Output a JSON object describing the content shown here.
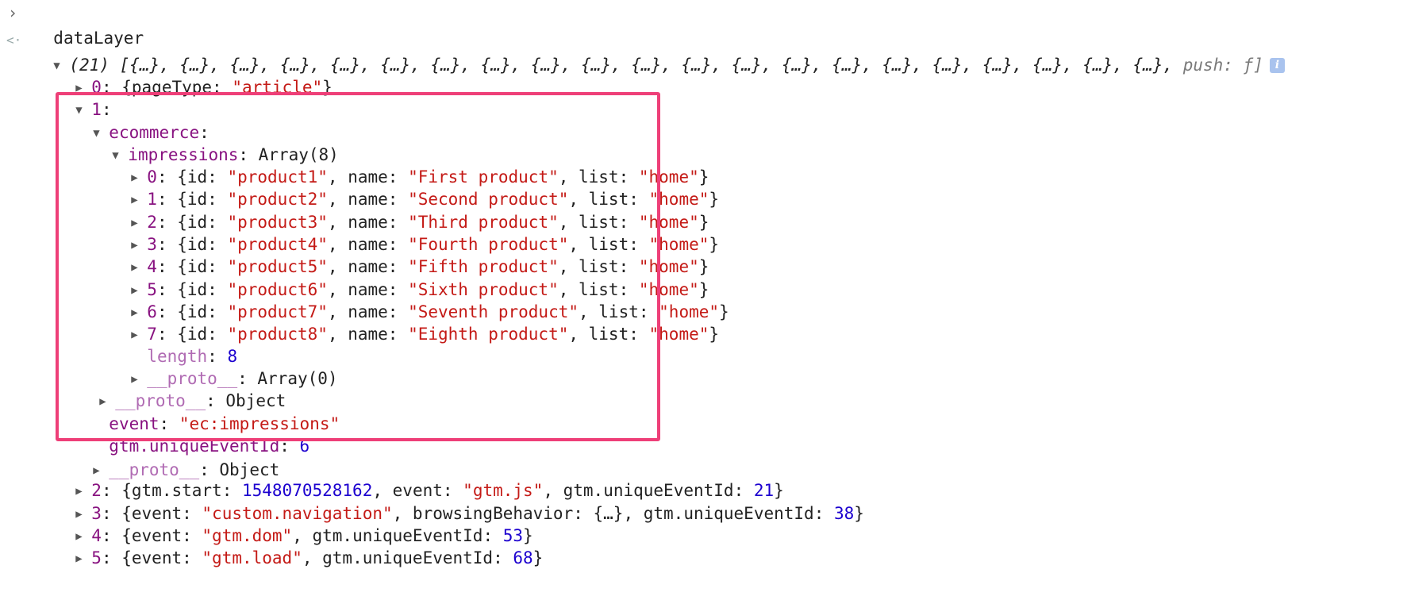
{
  "console": {
    "input_expression": "dataLayer",
    "summary_count": "(21)",
    "summary_items": "[{…}, {…}, {…}, {…}, {…}, {…}, {…}, {…}, {…}, {…}, {…}, {…}, {…}, {…}, {…}, {…}, {…}, {…}, {…}, {…}, {…}, ",
    "summary_push": "push: ƒ]",
    "info_badge": "i"
  },
  "entry0": {
    "index": "0",
    "key": "pageType",
    "value": "\"article\""
  },
  "entry1": {
    "index": "1"
  },
  "ecommerce": {
    "key": "ecommerce",
    "impressions_key": "impressions",
    "impressions_type": "Array(8)",
    "products": [
      {
        "index": "0",
        "id": "\"product1\"",
        "name": "\"First product\"",
        "list": "\"home\""
      },
      {
        "index": "1",
        "id": "\"product2\"",
        "name": "\"Second product\"",
        "list": "\"home\""
      },
      {
        "index": "2",
        "id": "\"product3\"",
        "name": "\"Third product\"",
        "list": "\"home\""
      },
      {
        "index": "3",
        "id": "\"product4\"",
        "name": "\"Fourth product\"",
        "list": "\"home\""
      },
      {
        "index": "4",
        "id": "\"product5\"",
        "name": "\"Fifth product\"",
        "list": "\"home\""
      },
      {
        "index": "5",
        "id": "\"product6\"",
        "name": "\"Sixth product\"",
        "list": "\"home\""
      },
      {
        "index": "6",
        "id": "\"product7\"",
        "name": "\"Seventh product\"",
        "list": "\"home\""
      },
      {
        "index": "7",
        "id": "\"product8\"",
        "name": "\"Eighth product\"",
        "list": "\"home\""
      }
    ],
    "length_key": "length",
    "length_value": "8",
    "array_proto_key": "__proto__",
    "array_proto_value": "Array(0)",
    "ecommerce_proto_key": "__proto__",
    "ecommerce_proto_value": "Object",
    "event_key": "event",
    "event_value": "\"ec:impressions\"",
    "unique_key": "gtm.uniqueEventId",
    "unique_value": "6"
  },
  "entry1_proto": {
    "key": "__proto__",
    "value": "Object"
  },
  "entry2": {
    "index": "2",
    "start_key": "gtm.start",
    "start_value": "1548070528162",
    "event_key": "event",
    "event_value": "\"gtm.js\"",
    "unique_key": "gtm.uniqueEventId",
    "unique_value": "21"
  },
  "entry3": {
    "index": "3",
    "event_key": "event",
    "event_value": "\"custom.navigation\"",
    "bb_key": "browsingBehavior",
    "bb_value": "{…}",
    "unique_key": "gtm.uniqueEventId",
    "unique_value": "38"
  },
  "entry4": {
    "index": "4",
    "event_key": "event",
    "event_value": "\"gtm.dom\"",
    "unique_key": "gtm.uniqueEventId",
    "unique_value": "53"
  },
  "entry5": {
    "index": "5",
    "event_key": "event",
    "event_value": "\"gtm.load\"",
    "unique_key": "gtm.uniqueEventId",
    "unique_value": "68"
  },
  "highlight_color": "#ee3f78"
}
